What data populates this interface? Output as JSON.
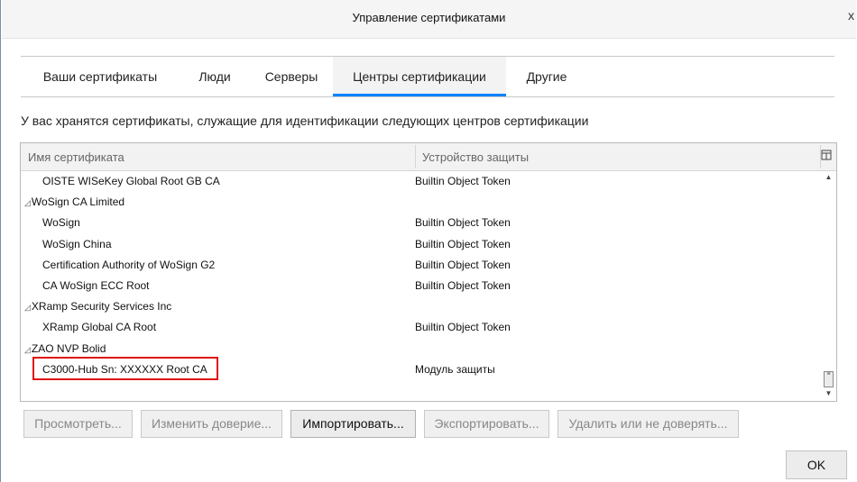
{
  "window": {
    "title": "Управление сертификатами",
    "close_glyph": "x"
  },
  "tabs": [
    {
      "label": "Ваши сертификаты",
      "active": false
    },
    {
      "label": "Люди",
      "active": false
    },
    {
      "label": "Серверы",
      "active": false
    },
    {
      "label": "Центры сертификации",
      "active": true
    },
    {
      "label": "Другие",
      "active": false
    }
  ],
  "description": "У вас хранятся сертификаты, служащие для идентификации следующих центров сертификации",
  "table": {
    "columns": [
      "Имя сертификата",
      "Устройство защиты"
    ],
    "column_picker_icon": "column-picker-icon",
    "rows": [
      {
        "type": "item",
        "name": "OISTE WISeKey Global Root GB CA",
        "device": "Builtin Object Token"
      },
      {
        "type": "group",
        "name": "WoSign CA Limited",
        "device": ""
      },
      {
        "type": "item",
        "name": "WoSign",
        "device": "Builtin Object Token"
      },
      {
        "type": "item",
        "name": "WoSign China",
        "device": "Builtin Object Token"
      },
      {
        "type": "item",
        "name": "Certification Authority of WoSign G2",
        "device": "Builtin Object Token"
      },
      {
        "type": "item",
        "name": "CA WoSign ECC Root",
        "device": "Builtin Object Token"
      },
      {
        "type": "group",
        "name": "XRamp Security Services Inc",
        "device": ""
      },
      {
        "type": "item",
        "name": "XRamp Global CA Root",
        "device": "Builtin Object Token"
      },
      {
        "type": "group",
        "name": "ZAO NVP Bolid",
        "device": ""
      },
      {
        "type": "item",
        "name": "C3000-Hub Sn: XXXXXX  Root CA",
        "device": "Модуль защиты",
        "highlighted": true
      }
    ]
  },
  "buttons": {
    "view": "Просмотреть...",
    "edit_trust": "Изменить доверие...",
    "import": "Импортировать...",
    "export": "Экспортировать...",
    "delete": "Удалить или не доверять...",
    "ok": "OK"
  },
  "colors": {
    "active_tab_accent": "#0a84ff",
    "highlight_box": "#e01010"
  }
}
